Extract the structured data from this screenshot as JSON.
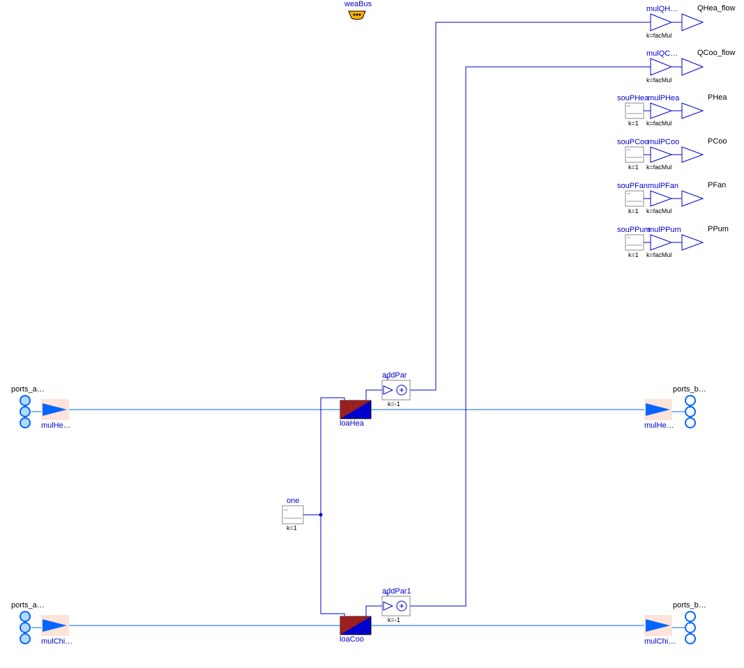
{
  "bus": {
    "label": "weaBus"
  },
  "ports": {
    "a_hea": "ports_a…",
    "b_hea": "ports_b…",
    "a_chi": "ports_a…",
    "b_chi": "ports_b…"
  },
  "mulIn": {
    "hea": "mulHe…",
    "chi": "mulChi…"
  },
  "mulOut": {
    "hea": "mulHe…",
    "chi": "mulChi…"
  },
  "loads": {
    "hea": {
      "name": "loaHea"
    },
    "coo": {
      "name": "loaCoo"
    }
  },
  "one": {
    "name": "one",
    "k": "k=1"
  },
  "addPar": {
    "name": "addPar",
    "k": "k=-1"
  },
  "addPar1": {
    "name": "addPar1",
    "k": "k=-1"
  },
  "outputs": {
    "QHea": {
      "mul": "mulQH…",
      "k": "k=facMul",
      "out": "QHea_flow"
    },
    "QCoo": {
      "mul": "mulQC…",
      "k": "k=facMul",
      "out": "QCoo_flow"
    },
    "PHea": {
      "sou": "souPHea",
      "souk": "k=1",
      "mul": "mulPHea",
      "k": "k=facMul",
      "out": "PHea"
    },
    "PCoo": {
      "sou": "souPCoo",
      "souk": "k=1",
      "mul": "mulPCoo",
      "k": "k=facMul",
      "out": "PCoo"
    },
    "PFan": {
      "sou": "souPFan",
      "souk": "k=1",
      "mul": "mulPFan",
      "k": "k=facMul",
      "out": "PFan"
    },
    "PPum": {
      "sou": "souPPum",
      "souk": "k=1",
      "mul": "mulPPum",
      "k": "k=facMul",
      "out": "PPum"
    }
  }
}
